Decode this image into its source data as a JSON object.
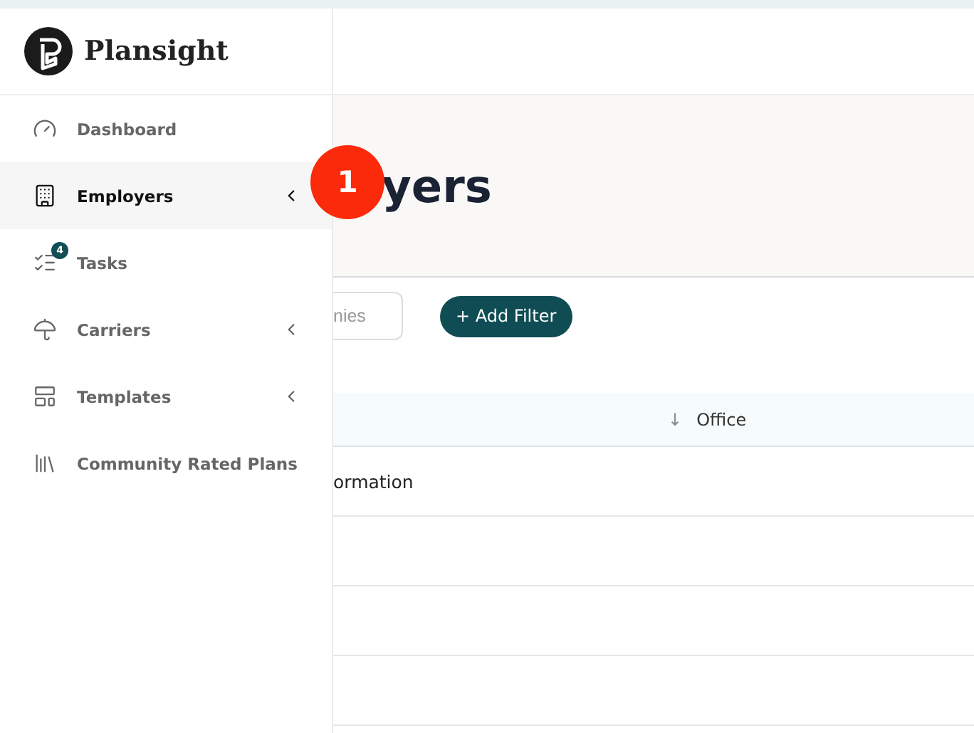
{
  "brand": {
    "name": "Plansight"
  },
  "sidebar": {
    "items": [
      {
        "kind": "gauge",
        "label": "Dashboard",
        "selected": false
      },
      {
        "kind": "building",
        "label": "Employers",
        "selected": true,
        "chevron": true
      },
      {
        "kind": "tasks",
        "label": "Tasks",
        "selected": false,
        "badge": "4"
      },
      {
        "kind": "umbrella",
        "label": "Carriers",
        "selected": false,
        "chevron": true
      },
      {
        "kind": "templates",
        "label": "Templates",
        "selected": false,
        "chevron": true
      },
      {
        "kind": "library",
        "label": "Community Rated Plans",
        "selected": false
      }
    ]
  },
  "step_marker": "1",
  "page_title": "yers",
  "search": {
    "placeholder": "nies"
  },
  "add_filter_button": "+ Add Filter",
  "table": {
    "columns": [
      {
        "sort_icon": "↓",
        "label": "Office"
      }
    ],
    "rows": [
      {
        "cell": "ormation"
      },
      {
        "cell": ""
      },
      {
        "cell": ""
      },
      {
        "cell": ""
      }
    ]
  }
}
